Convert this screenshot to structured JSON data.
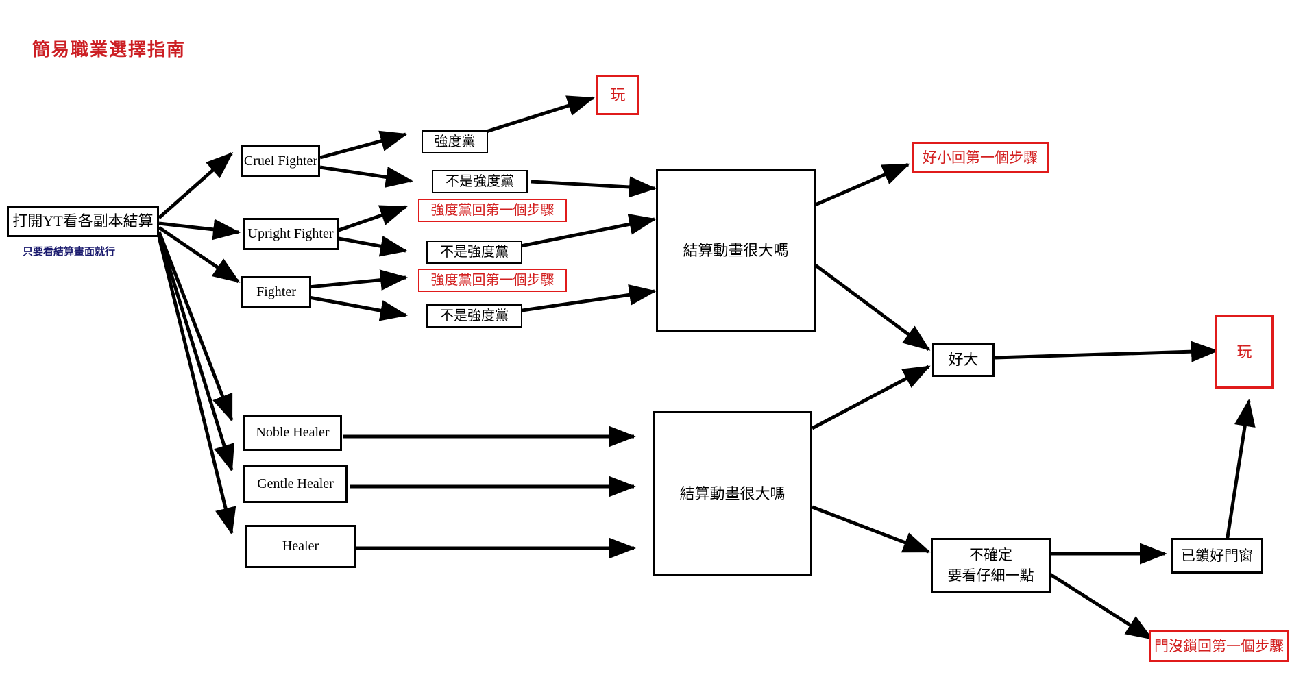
{
  "title": "簡易職業選擇指南",
  "start": {
    "label": "打開YT看各副本結算",
    "note": "只要看結算畫面就行"
  },
  "classes": {
    "fighters": [
      {
        "label": "Cruel Fighter"
      },
      {
        "label": "Upright Fighter"
      },
      {
        "label": "Fighter"
      }
    ],
    "healers": [
      {
        "label": "Noble Healer"
      },
      {
        "label": "Gentle Healer"
      },
      {
        "label": "Healer"
      }
    ]
  },
  "party_labels": {
    "strong": "強度黨",
    "not_strong": "不是強度黨",
    "strong_restart": "強度黨回第一個步驟"
  },
  "fighter_branch": [
    {
      "label": "強度黨",
      "style": "black"
    },
    {
      "label": "不是強度黨",
      "style": "black"
    },
    {
      "label": "強度黨回第一個步驟",
      "style": "red"
    },
    {
      "label": "不是強度黨",
      "style": "black"
    },
    {
      "label": "強度黨回第一個步驟",
      "style": "red"
    },
    {
      "label": "不是強度黨",
      "style": "black"
    }
  ],
  "decisions": [
    {
      "label": "結算動畫很大嗎"
    },
    {
      "label": "結算動畫很大嗎"
    }
  ],
  "outcomes": {
    "play_top": "玩",
    "too_small_restart": "好小回第一個步驟",
    "very_big": "好大",
    "play_right": "玩",
    "uncertain": "不確定\n要看仔細一點",
    "doors_locked": "已鎖好門窗",
    "doors_unlocked_restart": "門沒鎖回第一個步驟"
  },
  "colors": {
    "title_red": "#cc1f24",
    "box_red": "#e01b1b",
    "text_red": "#d31f1f",
    "note_navy": "#1b1b6e",
    "line_black": "#000000"
  }
}
